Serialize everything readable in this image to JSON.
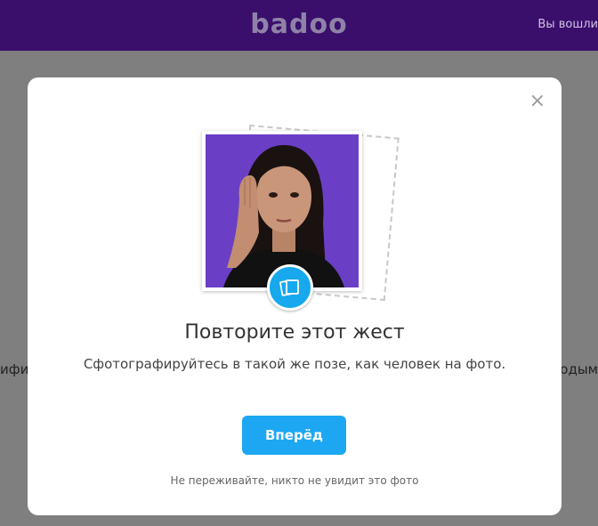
{
  "header": {
    "logo": "badoo",
    "right_text": "Вы вошли"
  },
  "background": {
    "left_fragment": "ифи",
    "right_fragment": "одым"
  },
  "modal": {
    "close_symbol": "×",
    "title": "Повторите этот жест",
    "subtitle": "Сфотографируйтесь в такой же позе, как человек на фото.",
    "button_label": "Вперёд",
    "note": "Не переживайте, никто не увидит это фото"
  },
  "colors": {
    "header_bg": "#3a0e6b",
    "accent": "#1da7f2",
    "photo_bg": "#6a3fc6"
  }
}
